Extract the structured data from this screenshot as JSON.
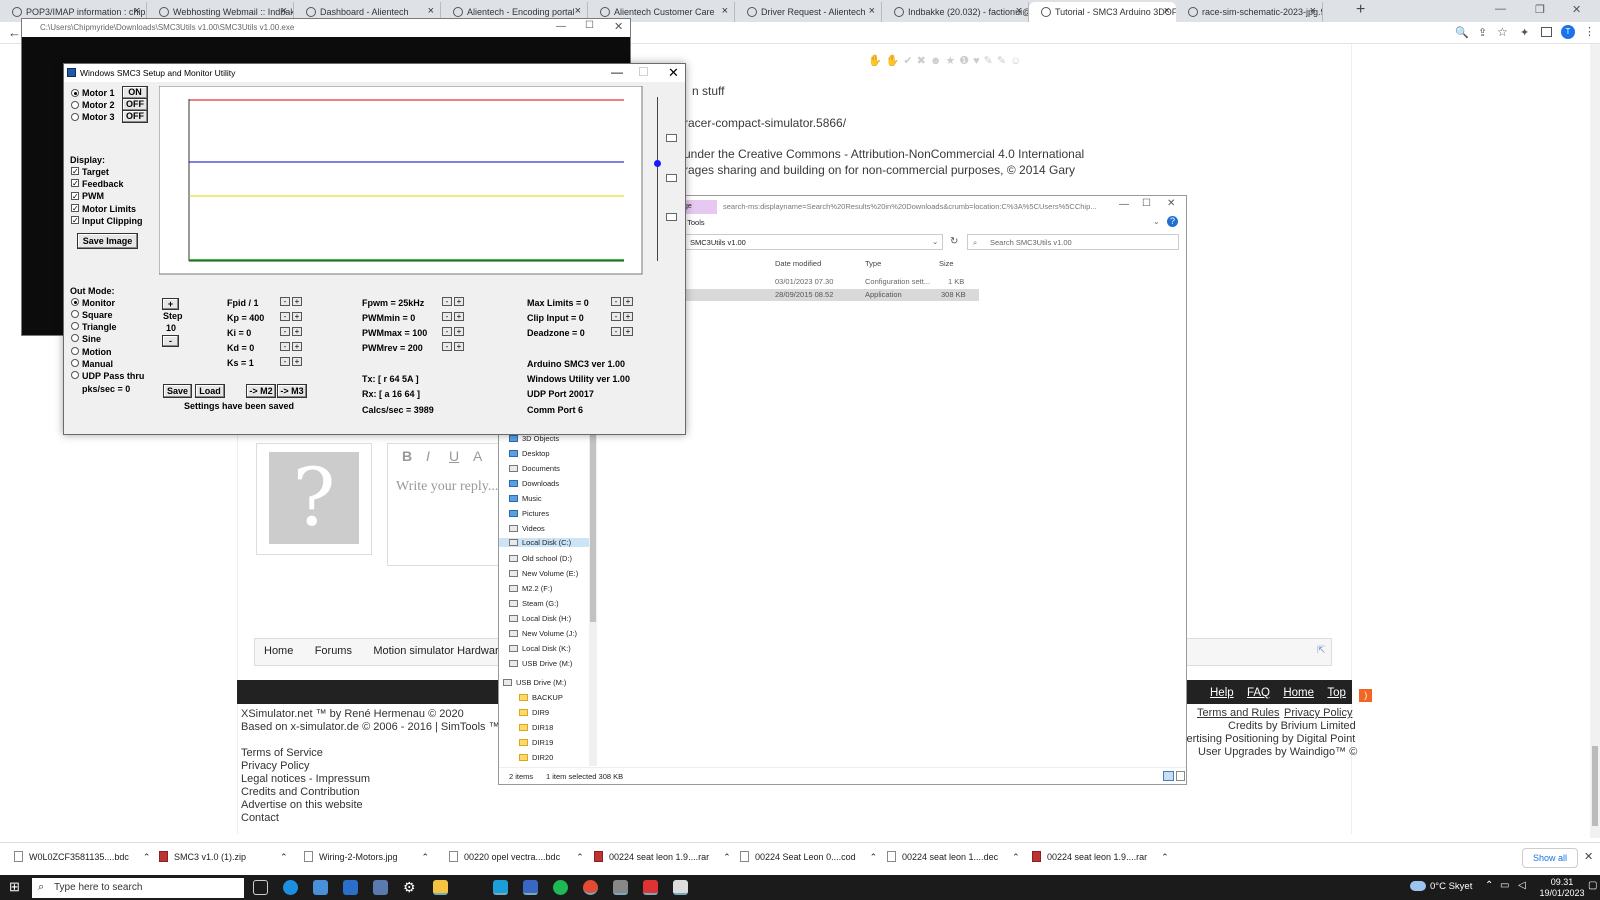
{
  "browser": {
    "tabs": [
      {
        "title": "POP3/IMAP information : chipmy"
      },
      {
        "title": "Webhosting Webmail :: Indbakke"
      },
      {
        "title": "Dashboard - Alientech"
      },
      {
        "title": "Alientech - Encoding portal"
      },
      {
        "title": "Alientech Customer Care"
      },
      {
        "title": "Driver Request - Alientech"
      },
      {
        "title": "Indbakke (20.032) - factionui@g"
      },
      {
        "title": "Tutorial - SMC3 Arduino 3DOF N"
      },
      {
        "title": "race-sim-schematic-2023-jpg.95"
      }
    ],
    "new_tab": "+",
    "close_glyph": "×",
    "back_glyph": "←",
    "profile_initial": "T"
  },
  "page": {
    "text1": "n stuff",
    "text2": "racer-compact-simulator.5866/",
    "text3": "under the Creative Commons - Attribution-NonCommercial 4.0 International",
    "text4": "rages sharing and building on for non-commercial purposes, © 2014 Gary",
    "reply_placeholder": "Write your reply...",
    "nav": [
      "Home",
      "Forums",
      "Motion simulator Hardware"
    ],
    "footer_links": [
      "Help",
      "FAQ",
      "Home",
      "Top"
    ],
    "footer_left1": "XSimulator.net ™ by René Hermenau © 2020",
    "footer_left2": "Based on x-simulator.de © 2006 - 2016 | SimTools ™ by",
    "footer_list": [
      "Terms of Service",
      "Privacy Policy",
      "Legal notices - Impressum",
      "Credits and Contribution",
      "Advertise on this website",
      "Contact"
    ],
    "footer_right1a": "Terms and Rules",
    "footer_right1b": "Privacy Policy",
    "footer_right2": "Credits by Brivium Limited",
    "footer_right3": "vertising Positioning by Digital Point",
    "footer_right4": "User Upgrades by Waindigo™ ©"
  },
  "console": {
    "title": "C:\\Users\\Chipmyride\\Downloads\\SMC3Utils v1.00\\SMC3Utils v1.00.exe"
  },
  "smc": {
    "title": "Windows SMC3 Setup and Monitor Utility",
    "motors": [
      {
        "label": "Motor 1",
        "state": "ON"
      },
      {
        "label": "Motor 2",
        "state": "OFF"
      },
      {
        "label": "Motor 3",
        "state": "OFF"
      }
    ],
    "display_label": "Display:",
    "display_opts": [
      "Target",
      "Feedback",
      "PWM",
      "Motor Limits",
      "Input Clipping"
    ],
    "save_image": "Save Image",
    "outmode_label": "Out Mode:",
    "outmodes": [
      "Monitor",
      "Square",
      "Triangle",
      "Sine",
      "Motion",
      "Manual",
      "UDP Pass thru"
    ],
    "pks": "pks/sec = 0",
    "step_plus": "+",
    "step_label": "Step",
    "step_value": "10",
    "step_minus": "-",
    "pid": [
      "Fpid / 1",
      "Kp = 400",
      "Ki = 0",
      "Kd = 0",
      "Ks = 1"
    ],
    "pwm": [
      "Fpwm = 25kHz",
      "PWMmin = 0",
      "PWMmax = 100",
      "PWMrev = 200"
    ],
    "limits": [
      "Max Limits = 0",
      "Clip Input = 0",
      "Deadzone = 0"
    ],
    "tx": "Tx: [ r 64 5A ]",
    "rx": "Rx: [ a 16 64 ]",
    "calcs": "Calcs/sec = 3989",
    "arduino_ver": "Arduino SMC3 ver 1.00",
    "windows_ver": "Windows Utility ver 1.00",
    "udp_port": "UDP Port 20017",
    "comm_port": "Comm Port 6",
    "btn_save": "Save",
    "btn_load": "Load",
    "btn_m2": "-> M2",
    "btn_m3": "-> M3",
    "status": "Settings have been saved",
    "spin_minus": "-",
    "spin_plus": "+"
  },
  "explorer": {
    "address_path": "search-ms:displayname=Search%20Results%20in%20Downloads&crumb=location:C%3A%5CUsers%5CChip...",
    "ribbon_tab": "ge",
    "ribbon_sub": "h Tools",
    "breadcrumb": "SMC3Utils v1.00",
    "search_placeholder": "Search SMC3Utils v1.00",
    "columns": [
      "Date modified",
      "Type",
      "Size"
    ],
    "rows": [
      {
        "name": "",
        "date": "03/01/2023 07.30",
        "type": "Configuration sett...",
        "size": "1 KB"
      },
      {
        "name": "e",
        "date": "28/09/2015 08.52",
        "type": "Application",
        "size": "308 KB"
      }
    ],
    "nav_items": [
      "3D Objects",
      "Desktop",
      "Documents",
      "Downloads",
      "Music",
      "Pictures",
      "Videos",
      "Local Disk (C:)",
      "Old school (D:)",
      "New Volume (E:)",
      "M2.2 (F:)",
      "Steam (G:)",
      "Local Disk (H:)",
      "New Volume (J:)",
      "Local Disk (K:)",
      "USB Drive (M:)",
      "USB Drive (M:)",
      "BACKUP",
      "DIR9",
      "DIR18",
      "DIR19",
      "DIR20"
    ],
    "status_items": "2 items",
    "status_selected": "1 item selected  308 KB"
  },
  "downloads": {
    "items": [
      "W0L0ZCF3581135....bdc",
      "SMC3 v1.0 (1).zip",
      "Wiring-2-Motors.jpg",
      "00220 opel vectra....bdc",
      "00224 seat leon 1.9....rar",
      "00224 Seat Leon 0....cod",
      "00224 seat leon 1....dec",
      "00224 seat leon 1.9....rar"
    ],
    "show_all": "Show all"
  },
  "taskbar": {
    "search_placeholder": "Type here to search",
    "weather": "0°C  Skyet",
    "time": "09.31",
    "date": "19/01/2023"
  },
  "colors": {
    "plot_red": "#d40000",
    "plot_blue": "#0000d0",
    "plot_yellow": "#e0d000",
    "plot_green": "#00a000"
  }
}
